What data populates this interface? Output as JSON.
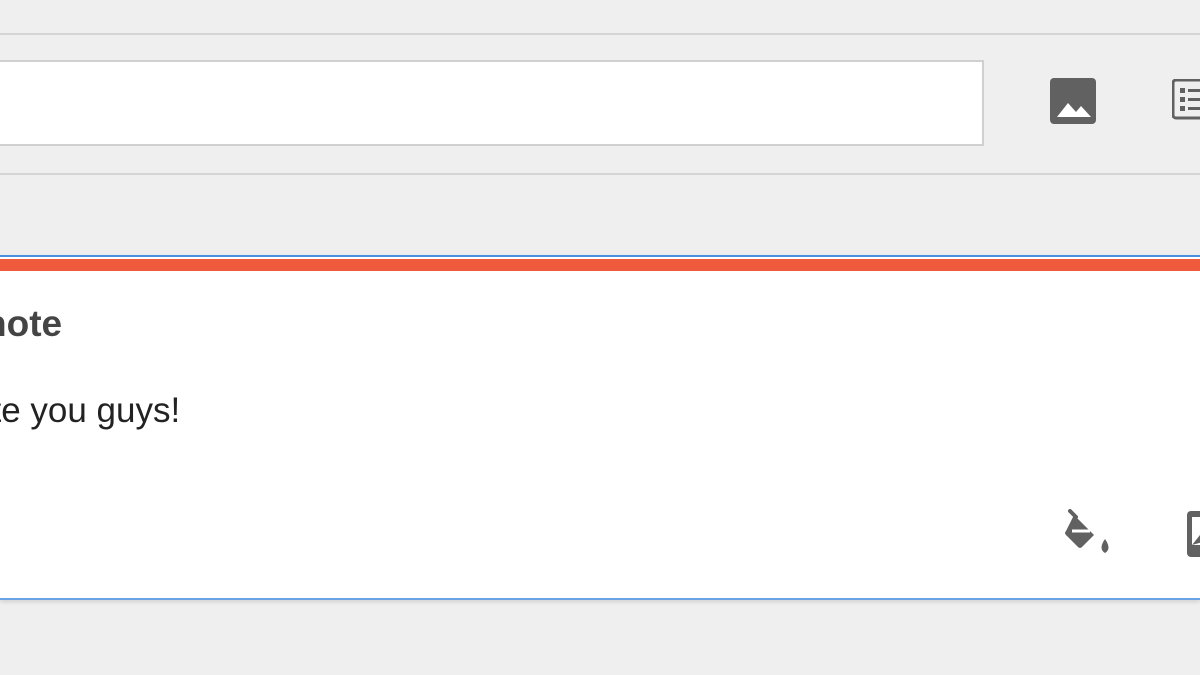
{
  "toolbar": {
    "search_value": "",
    "image_icon": "image-icon",
    "list_icon": "checklist-icon"
  },
  "note": {
    "title": "note",
    "body": "ote you guys!",
    "accent_color": "#f05a3c",
    "icons": [
      "paint-bucket-icon",
      "image-icon"
    ]
  },
  "colors": {
    "background": "#efefef",
    "card": "#ffffff",
    "card_border": "#4a8fe0",
    "icon": "#616161"
  }
}
